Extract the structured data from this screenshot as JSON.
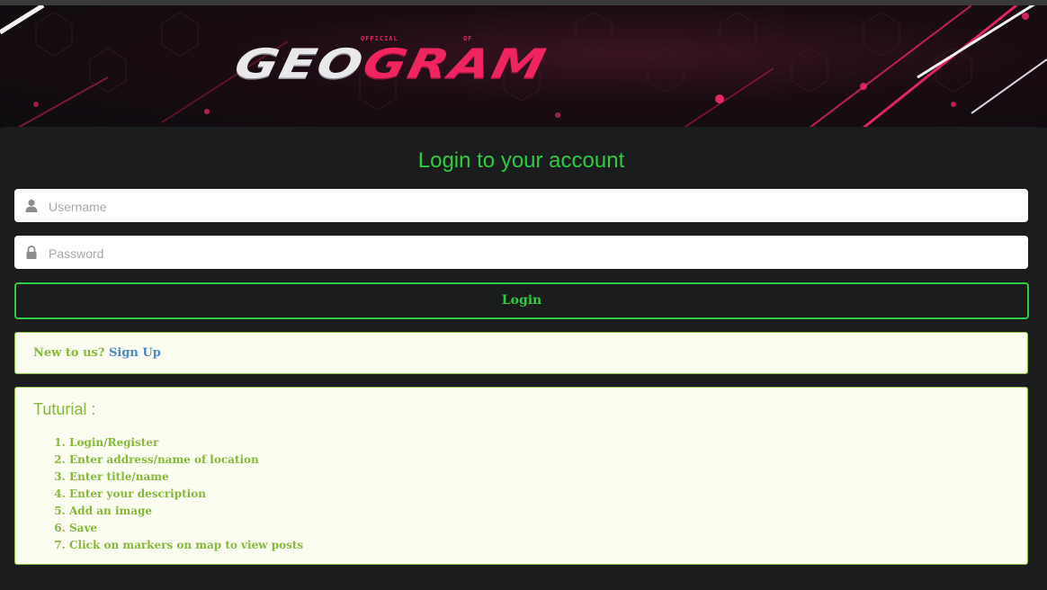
{
  "banner": {
    "small_left": "OFFICIAL",
    "small_right": "OF",
    "logo_part1": "GEO",
    "logo_part2": "GRAM"
  },
  "login": {
    "heading": "Login to your account",
    "username_placeholder": "Username",
    "password_placeholder": "Password",
    "button_label": "Login"
  },
  "signup": {
    "prompt": "New to us?",
    "link_label": "Sign Up"
  },
  "tutorial": {
    "title": "Tuturial :",
    "steps": [
      "Login/Register",
      "Enter address/name of location",
      "Enter title/name",
      "Enter your description",
      "Add an image",
      "Save",
      "Click on markers on map to view posts"
    ]
  },
  "colors": {
    "accent_green": "#2ecc40",
    "brand_pink": "#f0245f",
    "info_green": "#86b83a",
    "link_blue": "#4a89c8"
  },
  "icons": {
    "username": "user-icon",
    "password": "lock-icon"
  }
}
